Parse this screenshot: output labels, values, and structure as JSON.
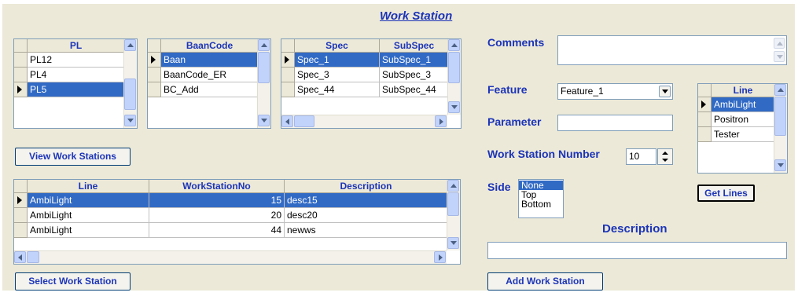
{
  "title": "Work Station",
  "pl_grid": {
    "header": "PL",
    "rows": [
      "PL12",
      "PL4",
      "PL5"
    ],
    "selected": 2
  },
  "baan_grid": {
    "header": "BaanCode",
    "rows": [
      "Baan",
      "BaanCode_ER",
      "BC_Add"
    ],
    "selected": 0
  },
  "spec_grid": {
    "headers": [
      "Spec",
      "SubSpec"
    ],
    "rows": [
      [
        "Spec_1",
        "SubSpec_1"
      ],
      [
        "Spec_3",
        "SubSpec_3"
      ],
      [
        "Spec_44",
        "SubSpec_44"
      ]
    ],
    "selected": 0
  },
  "view_button": "View Work Stations",
  "ws_grid": {
    "headers": [
      "Line",
      "WorkStationNo",
      "Description"
    ],
    "rows": [
      [
        "AmbiLight",
        "15",
        "desc15"
      ],
      [
        "AmbiLight",
        "20",
        "desc20"
      ],
      [
        "AmbiLight",
        "44",
        "newws"
      ]
    ],
    "selected": 0
  },
  "select_button": "Select Work Station",
  "form": {
    "comments_label": "Comments",
    "comments_value": "",
    "feature_label": "Feature",
    "feature_value": "Feature_1",
    "parameter_label": "Parameter",
    "parameter_value": "",
    "wsn_label": "Work Station Number",
    "wsn_value": "10",
    "side_label": "Side",
    "side_options": [
      "None",
      "Top",
      "Bottom"
    ],
    "side_selected": 0,
    "description_label": "Description",
    "description_value": "",
    "add_button": "Add Work Station"
  },
  "line_grid": {
    "header": "Line",
    "rows": [
      "AmbiLight",
      "Positron",
      "Tester"
    ],
    "selected": 0
  },
  "get_lines_button": "Get Lines"
}
